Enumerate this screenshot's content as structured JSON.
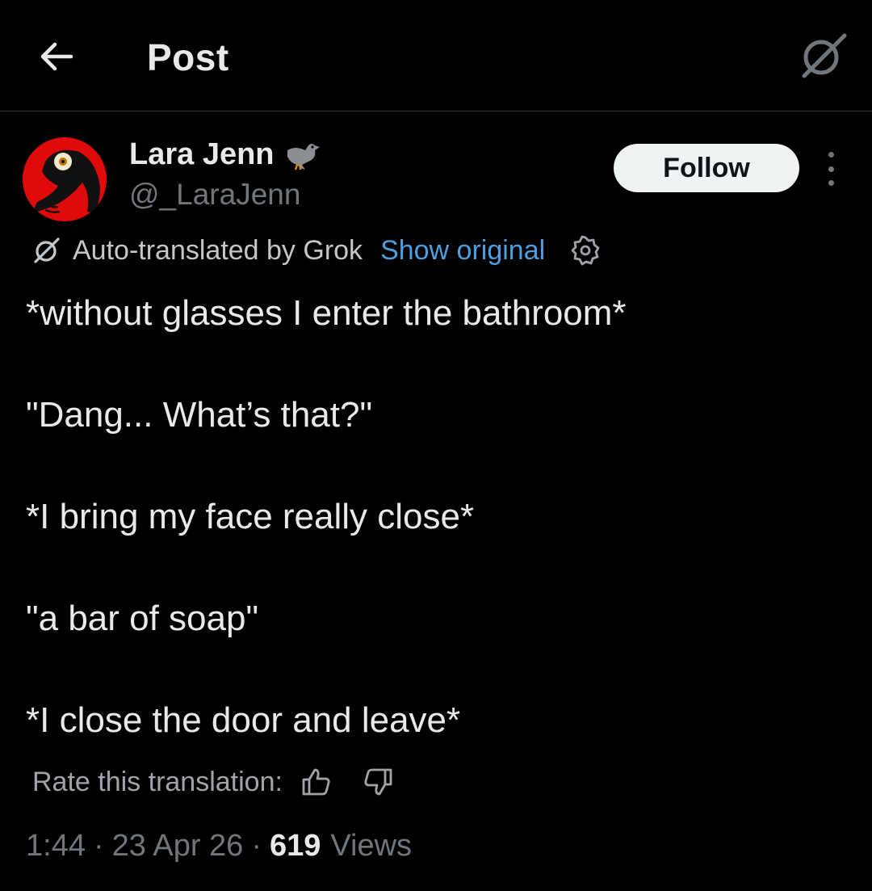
{
  "header": {
    "title": "Post",
    "back_icon": "arrow-left-icon",
    "grok_icon": "grok-icon"
  },
  "author": {
    "name": "Lara Jenn",
    "handle": "@_LaraJenn",
    "badge_icon": "bird-icon",
    "avatar_color": "#e00a0a"
  },
  "actions": {
    "follow_label": "Follow",
    "more_icon": "more-vertical-icon"
  },
  "translation": {
    "label": "Auto-translated by Grok",
    "show_original": "Show original",
    "link_color": "#4b9fe0"
  },
  "post": {
    "lines": [
      "*without glasses I enter the bathroom*",
      "\"Dang... What’s that?\"",
      "*I bring my face really close*",
      "\"a bar of soap\"",
      "*I close the door and leave*"
    ]
  },
  "rating": {
    "label": "Rate this translation:",
    "up_icon": "thumbs-up-icon",
    "down_icon": "thumbs-down-icon"
  },
  "meta": {
    "time": "1:44",
    "date": "23 Apr 26",
    "separator": "·",
    "views_count": "619",
    "views_label": "Views"
  }
}
